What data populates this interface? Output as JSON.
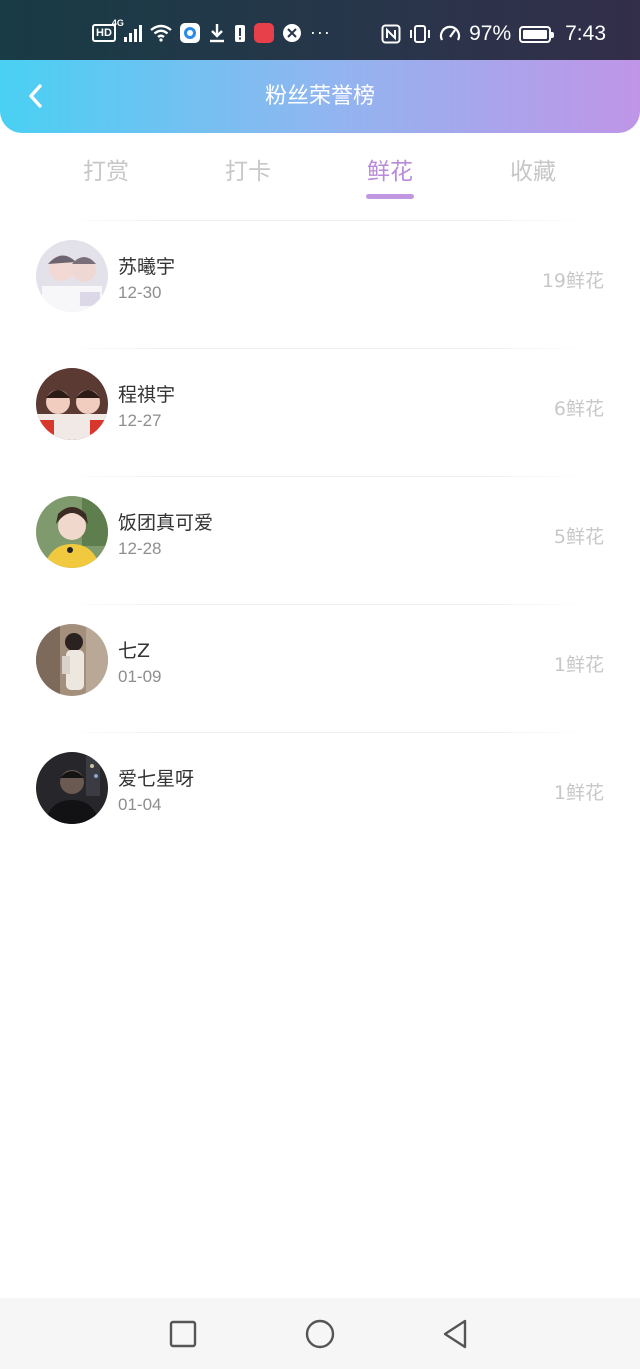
{
  "status_bar": {
    "hd": "HD",
    "network": "4G",
    "battery_percent": "97%",
    "time": "7:43",
    "icons": [
      "hd-icon",
      "signal-icon",
      "wifi-icon",
      "app-icon",
      "download-icon",
      "alert-icon",
      "huawei-store-icon",
      "app-icon-2",
      "more-icon",
      "nfc-icon",
      "vibrate-icon",
      "speed-icon",
      "battery-icon"
    ]
  },
  "header": {
    "title": "粉丝荣誉榜",
    "back_icon": "chevron-left-icon"
  },
  "tabs": [
    {
      "label": "打赏",
      "active": false
    },
    {
      "label": "打卡",
      "active": false
    },
    {
      "label": "鲜花",
      "active": true
    },
    {
      "label": "收藏",
      "active": false
    }
  ],
  "list": [
    {
      "name": "苏曦宇",
      "date": "12-30",
      "count": "19鲜花"
    },
    {
      "name": "程祺宇",
      "date": "12-27",
      "count": "6鲜花"
    },
    {
      "name": "饭团真可爱",
      "date": "12-28",
      "count": "5鲜花"
    },
    {
      "name": "七Z",
      "date": "01-09",
      "count": "1鲜花"
    },
    {
      "name": "爱七星呀",
      "date": "01-04",
      "count": "1鲜花"
    }
  ],
  "nav": {
    "icons": [
      "recents-square-icon",
      "home-circle-icon",
      "back-triangle-icon"
    ]
  },
  "colors": {
    "header_gradient_start": "#49d0f3",
    "header_gradient_end": "#c095e8",
    "active_tab": "#b88ad9",
    "inactive_tab": "#c7c7c7"
  }
}
